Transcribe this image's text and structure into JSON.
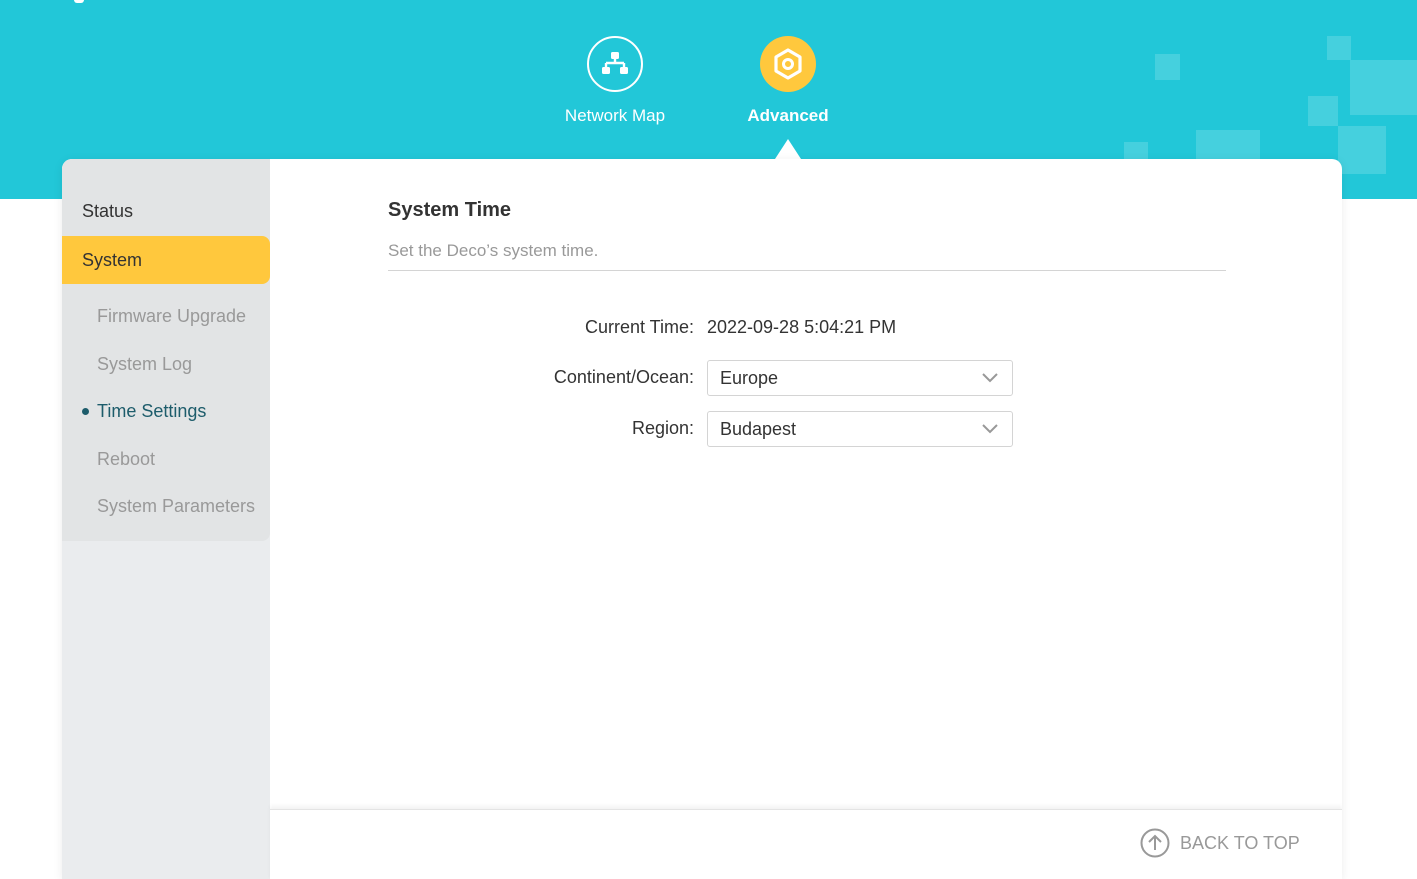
{
  "nav": {
    "tabs": [
      {
        "label": "Network Map",
        "icon": "network-map-icon",
        "active": false
      },
      {
        "label": "Advanced",
        "icon": "advanced-gear-icon",
        "active": true
      }
    ]
  },
  "sidebar": {
    "items": [
      {
        "label": "Status",
        "active": false
      },
      {
        "label": "System",
        "active": true
      }
    ],
    "subitems": [
      {
        "label": "Firmware Upgrade",
        "current": false
      },
      {
        "label": "System Log",
        "current": false
      },
      {
        "label": "Time Settings",
        "current": true
      },
      {
        "label": "Reboot",
        "current": false
      },
      {
        "label": "System Parameters",
        "current": false
      }
    ]
  },
  "section": {
    "title": "System Time",
    "description": "Set the Deco’s system time."
  },
  "form": {
    "current_time_label": "Current Time:",
    "current_time_value": "2022-09-28 5:04:21 PM",
    "continent_label": "Continent/Ocean:",
    "continent_value": "Europe",
    "region_label": "Region:",
    "region_value": "Budapest"
  },
  "footer": {
    "back_to_top": "BACK TO TOP"
  },
  "colors": {
    "header": "#22c7d8",
    "accent": "#ffc83d",
    "sidebar": "#eaecee"
  }
}
